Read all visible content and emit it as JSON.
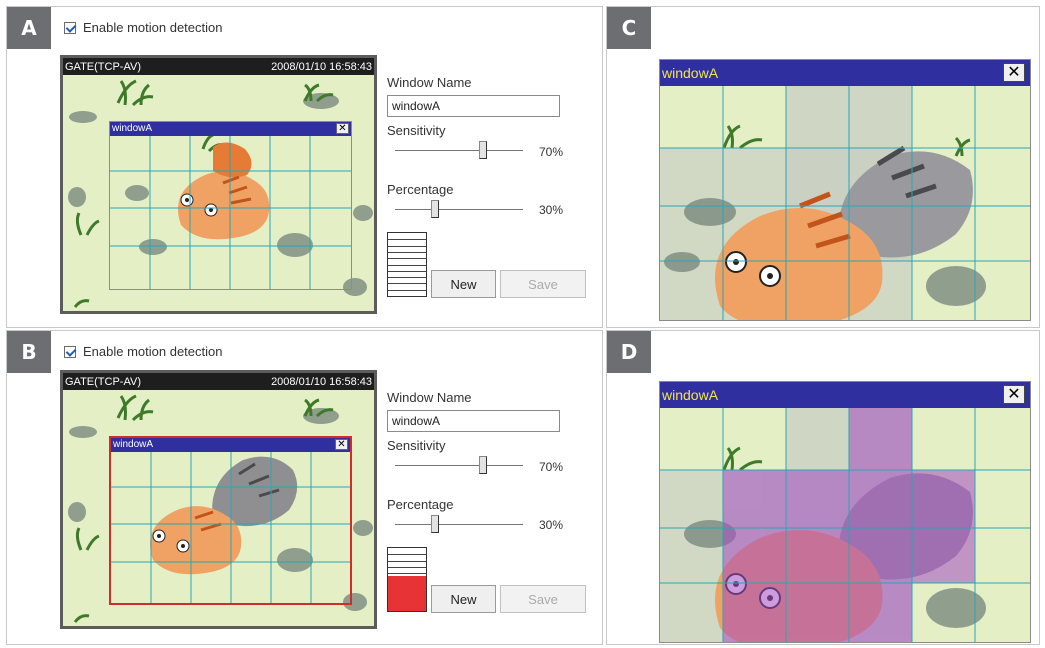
{
  "panels": {
    "a": {
      "badge": "A",
      "enable_label": "Enable motion detection",
      "enabled": true,
      "camera": {
        "source": "GATE(TCP-AV)",
        "timestamp": "2008/01/10 16:58:43"
      },
      "window": {
        "title": "windowA",
        "close": "✕",
        "triggered": false
      },
      "form": {
        "window_name_label": "Window Name",
        "window_name_value": "windowA",
        "sensitivity_label": "Sensitivity",
        "sensitivity_value": "70%",
        "sensitivity_level": 0.7,
        "percentage_label": "Percentage",
        "percentage_value": "30%",
        "percentage_level": 0.3,
        "meter_fill": 0.0,
        "new_label": "New",
        "save_label": "Save"
      }
    },
    "b": {
      "badge": "B",
      "enable_label": "Enable motion detection",
      "enabled": true,
      "camera": {
        "source": "GATE(TCP-AV)",
        "timestamp": "2008/01/10 16:58:43"
      },
      "window": {
        "title": "windowA",
        "close": "✕",
        "triggered": true
      },
      "form": {
        "window_name_label": "Window Name",
        "window_name_value": "windowA",
        "sensitivity_label": "Sensitivity",
        "sensitivity_value": "70%",
        "sensitivity_level": 0.7,
        "percentage_label": "Percentage",
        "percentage_value": "30%",
        "percentage_level": 0.3,
        "meter_fill": 0.55,
        "new_label": "New",
        "save_label": "Save"
      }
    },
    "c": {
      "badge": "C",
      "window_title": "windowA",
      "close": "✕"
    },
    "d": {
      "badge": "D",
      "window_title": "windowA",
      "close": "✕"
    }
  },
  "colors": {
    "badge": "#6d6e71",
    "window_title_bar": "#2f2fa0",
    "zoom_title_text": "#f4e64a",
    "triggered_border": "#d42a2a",
    "meter_fill": "#e83336",
    "scene_background": "#e4efc6",
    "grid_lines": "#2aa6b5",
    "motion_overlay": "#a44cc4"
  },
  "icons": {
    "checkbox": "checkbox-checked-icon",
    "close": "close-icon"
  }
}
